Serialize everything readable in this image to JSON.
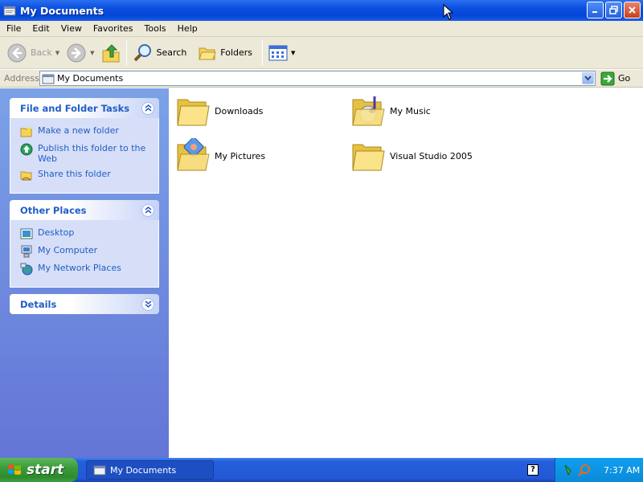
{
  "window": {
    "title": "My Documents"
  },
  "menu": {
    "items": [
      "File",
      "Edit",
      "View",
      "Favorites",
      "Tools",
      "Help"
    ]
  },
  "toolbar": {
    "back_label": "Back",
    "search_label": "Search",
    "folders_label": "Folders"
  },
  "address": {
    "label": "Address",
    "value": "My Documents",
    "go_label": "Go"
  },
  "tasks_panel": {
    "title": "File and Folder Tasks",
    "items": [
      "Make a new folder",
      "Publish this folder to the Web",
      "Share this folder"
    ]
  },
  "places_panel": {
    "title": "Other Places",
    "items": [
      "Desktop",
      "My Computer",
      "My Network Places"
    ]
  },
  "details_panel": {
    "title": "Details"
  },
  "folders": [
    "Downloads",
    "My Music",
    "My Pictures",
    "Visual Studio 2005"
  ],
  "taskbar": {
    "start_label": "start",
    "task_label": "My Documents",
    "clock": "7:37 AM"
  },
  "colors": {
    "title_blue": "#0a4fe0",
    "link_blue": "#215dc6",
    "pane_top": "#7ba2e7",
    "pane_bottom": "#6375d6",
    "start_green": "#3c9c3c"
  }
}
